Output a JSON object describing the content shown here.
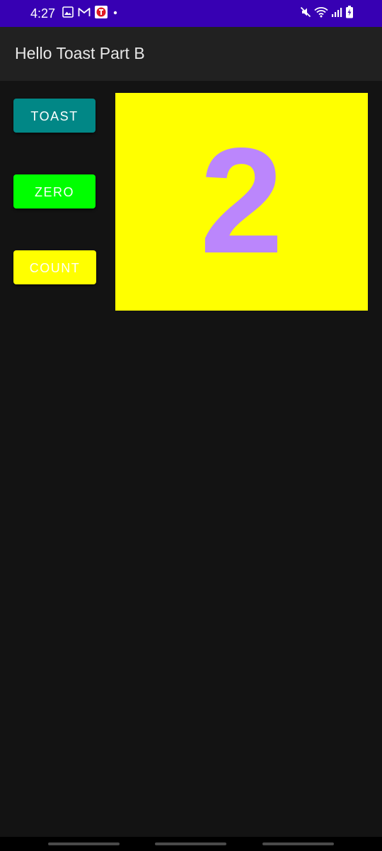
{
  "status_bar": {
    "time": "4:27",
    "left_icons": [
      "gallery-icon",
      "gmail-icon",
      "app-notification-icon",
      "dot-icon"
    ],
    "right_icons": [
      "mute-icon",
      "wifi-icon",
      "signal-icon",
      "battery-icon"
    ],
    "background_color": "#3700b3"
  },
  "app_bar": {
    "title": "Hello Toast Part B"
  },
  "buttons": {
    "toast_label": "TOAST",
    "zero_label": "ZERO",
    "count_label": "COUNT"
  },
  "counter": {
    "value": "2",
    "text_color": "#bb86fc",
    "background_color": "#ffff00"
  },
  "colors": {
    "toast_button": "#018786",
    "zero_button": "#00ff00",
    "count_button": "#ffff00",
    "window_background": "#131313"
  }
}
